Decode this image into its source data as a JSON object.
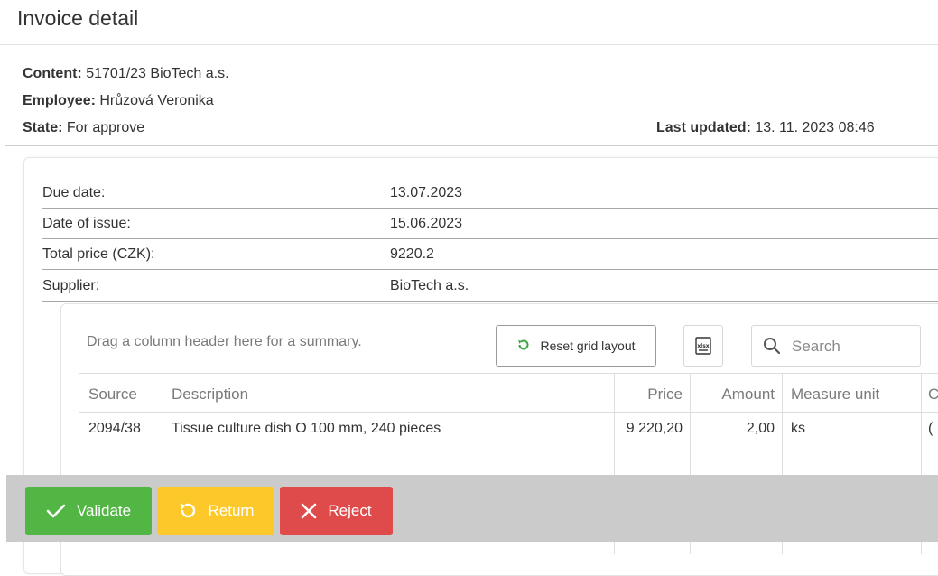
{
  "page": {
    "title": "Invoice detail"
  },
  "info": {
    "content_label": "Content:",
    "content_value": "51701/23 BioTech a.s.",
    "employee_label": "Employee:",
    "employee_value": "Hrůzová Veronika",
    "state_label": "State:",
    "state_value": "For approve",
    "updated_label": "Last updated:",
    "updated_value": "13. 11. 2023 08:46"
  },
  "properties": [
    {
      "label": "Due date:",
      "value": "13.07.2023"
    },
    {
      "label": "Date of issue:",
      "value": "15.06.2023"
    },
    {
      "label": "Total price (CZK):",
      "value": "9220.2"
    },
    {
      "label": "Supplier:",
      "value": "BioTech a.s."
    }
  ],
  "grid": {
    "group_hint": "Drag a column header here for a summary.",
    "reset_label": "Reset grid layout",
    "export_icon": "xlsx-export-icon",
    "search_placeholder": "Search",
    "columns": [
      "Source",
      "Description",
      "Price",
      "Amount",
      "Measure unit",
      "C"
    ],
    "rows": [
      {
        "source": "2094/38",
        "description": "Tissue culture dish O 100 mm, 240 pieces",
        "price": "9 220,20",
        "amount": "2,00",
        "unit": "ks",
        "extra": "("
      }
    ]
  },
  "actions": {
    "validate_label": "Validate",
    "return_label": "Return",
    "reject_label": "Reject",
    "colors": {
      "validate": "#51b644",
      "return": "#fdc829",
      "reject": "#df4b4b"
    }
  }
}
